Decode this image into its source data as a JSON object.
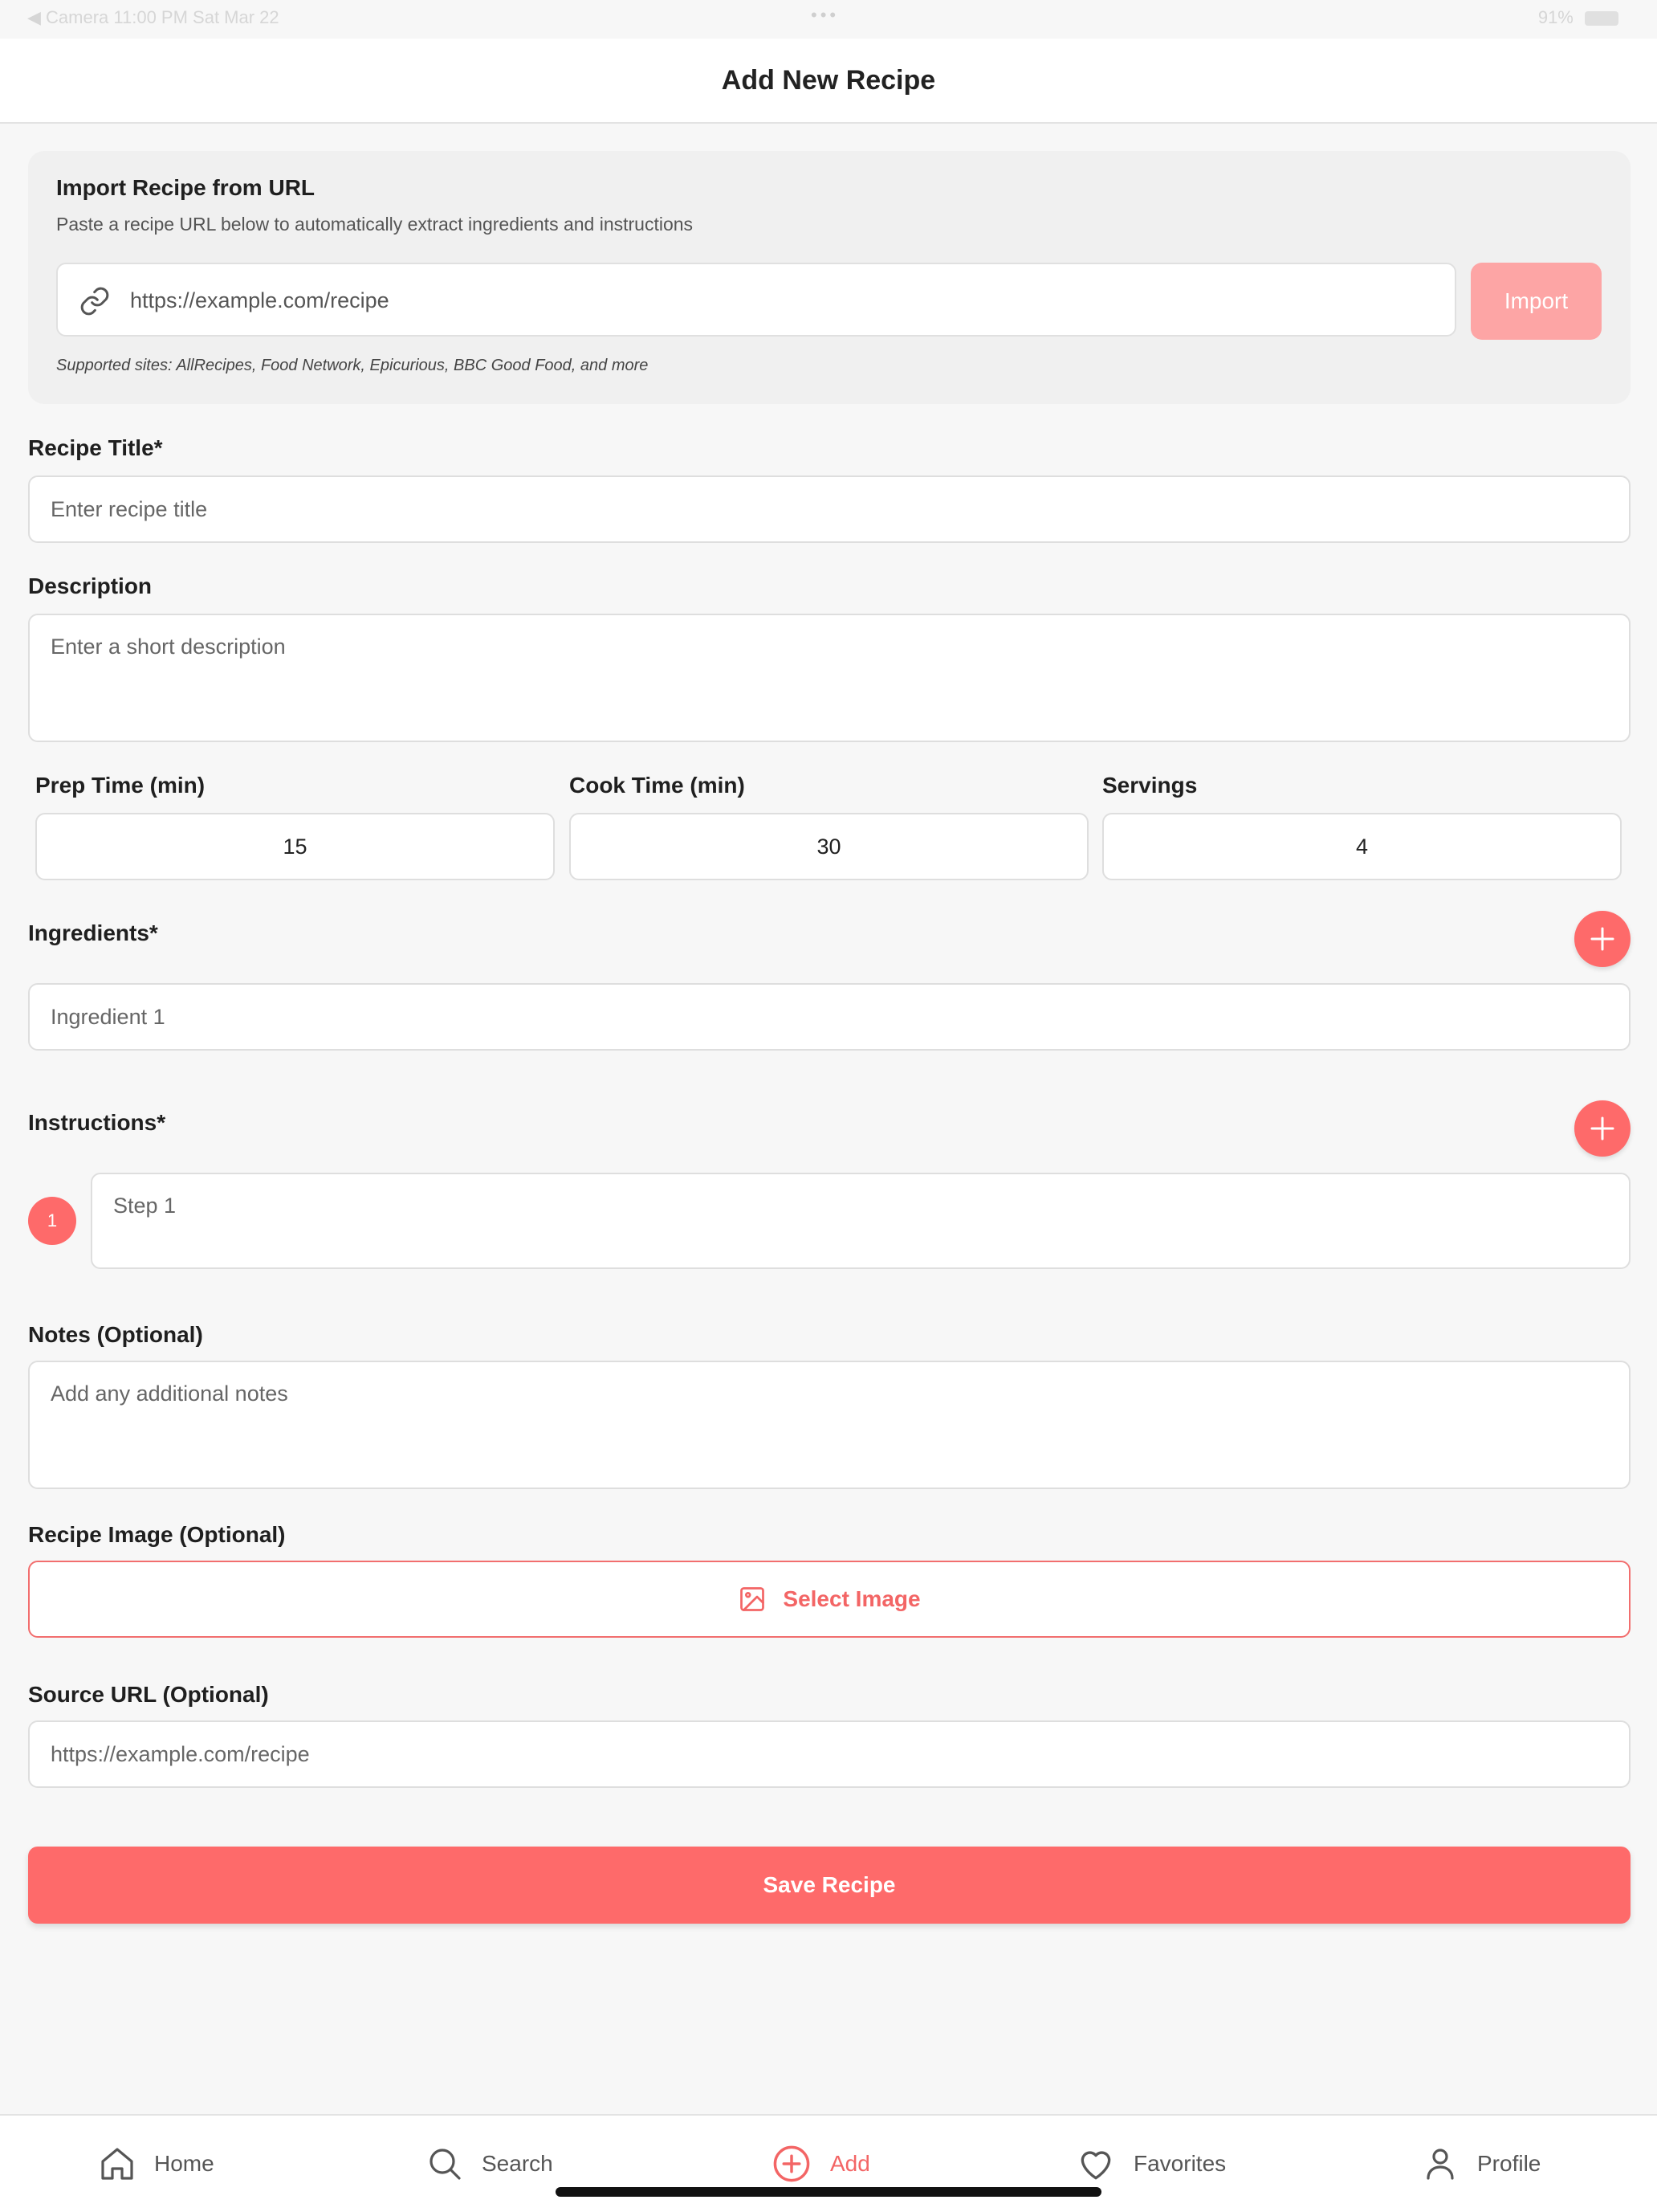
{
  "status_bar": {
    "left": "◀ Camera  11:00 PM  Sat Mar 22",
    "battery": "91%"
  },
  "header": {
    "title": "Add New Recipe"
  },
  "import": {
    "title": "Import Recipe from URL",
    "description": "Paste a recipe URL below to automatically extract ingredients and instructions",
    "url_placeholder": "https://example.com/recipe",
    "button_label": "Import",
    "supported": "Supported sites: AllRecipes, Food Network, Epicurious, BBC Good Food, and more",
    "icon": "link-icon"
  },
  "form": {
    "title_label": "Recipe Title*",
    "title_placeholder": "Enter recipe title",
    "description_label": "Description",
    "description_placeholder": "Enter a short description",
    "prep_label": "Prep Time (min)",
    "prep_value": "15",
    "cook_label": "Cook Time (min)",
    "cook_value": "30",
    "servings_label": "Servings",
    "servings_value": "4",
    "ingredients_label": "Ingredients*",
    "ingredient_placeholder": "Ingredient 1",
    "instructions_label": "Instructions*",
    "step_number": "1",
    "step_placeholder": "Step 1",
    "notes_label": "Notes (Optional)",
    "notes_placeholder": "Add any additional notes",
    "image_label": "Recipe Image (Optional)",
    "select_image_label": "Select Image",
    "source_label": "Source URL (Optional)",
    "source_placeholder": "https://example.com/recipe",
    "save_label": "Save Recipe"
  },
  "tabs": [
    {
      "label": "Home",
      "icon": "home-icon"
    },
    {
      "label": "Search",
      "icon": "search-icon"
    },
    {
      "label": "Add",
      "icon": "add-circle-icon",
      "active": true
    },
    {
      "label": "Favorites",
      "icon": "heart-icon"
    },
    {
      "label": "Profile",
      "icon": "profile-icon"
    }
  ],
  "colors": {
    "accent": "#fe6a6a",
    "import_disabled": "#fda5a5",
    "background": "#f7f7f7"
  }
}
